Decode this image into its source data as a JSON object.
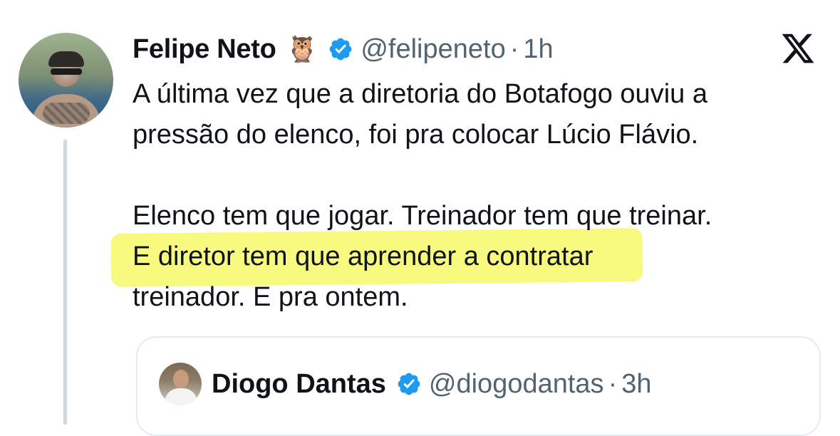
{
  "tweet": {
    "author_name": "Felipe Neto",
    "author_emoji": "🦉",
    "handle": "@felipeneto",
    "separator": "·",
    "time": "1h",
    "lines": [
      "A última vez que a diretoria do Botafogo ouviu a",
      "pressão do elenco, foi pra colocar Lúcio Flávio.",
      "",
      "Elenco tem que jogar. Treinador tem que treinar.",
      "E diretor tem que aprender a contratar",
      "treinador. E pra ontem."
    ]
  },
  "quoted_tweet": {
    "author_name": "Diogo Dantas",
    "handle": "@diogodantas",
    "separator": "·",
    "time": "3h"
  },
  "icons": {
    "platform_logo": "x-logo-icon",
    "verified": "verified-badge-icon"
  },
  "colors": {
    "verified_blue": "#1d9bf0",
    "secondary_text": "#536471",
    "highlight": "#f7f96a"
  }
}
